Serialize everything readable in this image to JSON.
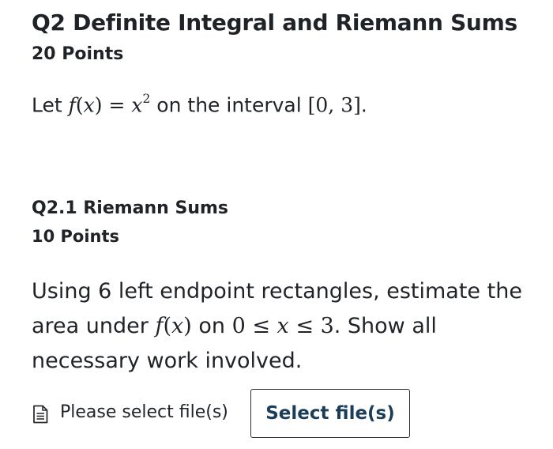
{
  "question": {
    "title": "Q2 Definite Integral and Riemann Sums",
    "points": "20 Points",
    "intro": {
      "prefix": "Let ",
      "fx": "f",
      "open_paren": "(",
      "x1": "x",
      "close_paren": ")",
      "equals": " = ",
      "x2": "x",
      "exponent": "2",
      "middle": " on the interval ",
      "interval": "[0, 3]",
      "suffix": "."
    }
  },
  "subquestion": {
    "title": "Q2.1 Riemann Sums",
    "points": "10 Points",
    "prompt": {
      "part1": "Using 6 left endpoint rectangles, estimate the area under ",
      "fx": "f",
      "open_paren": "(",
      "x1": "x",
      "close_paren": ")",
      "part2": " on ",
      "range_start": "0 ≤ ",
      "range_x": "x",
      "range_end": " ≤ 3",
      "part3": ". Show all necessary work involved."
    }
  },
  "upload": {
    "icon": "file-text-icon",
    "status": "Please select file(s)",
    "button_label": "Select file(s)"
  }
}
